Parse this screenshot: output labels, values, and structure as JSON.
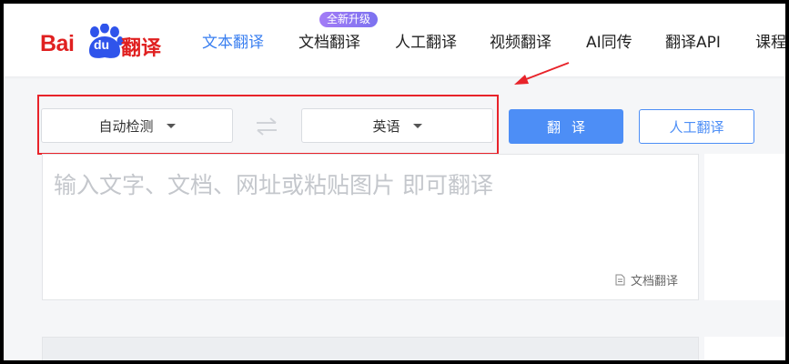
{
  "brand": {
    "logo_text_bai": "Bai",
    "logo_text_du": "du",
    "logo_text_fanyi": "翻译"
  },
  "nav": {
    "items": [
      {
        "label": "文本翻译",
        "active": true
      },
      {
        "label": "文档翻译",
        "active": false
      },
      {
        "label": "人工翻译",
        "active": false
      },
      {
        "label": "视频翻译",
        "active": false
      },
      {
        "label": "AI同传",
        "active": false
      },
      {
        "label": "翻译API",
        "active": false
      },
      {
        "label": "课程",
        "active": false
      }
    ],
    "badge": "全新升级"
  },
  "translator": {
    "source_language": "自动检测",
    "target_language": "英语",
    "translate_button": "翻译",
    "human_translate_button": "人工翻译",
    "input_placeholder": "输入文字、文档、网址或粘贴图片 即可翻译",
    "doc_translate_link": "文档翻译"
  },
  "colors": {
    "accent": "#4d8ef6",
    "nav_active": "#3a7ff0",
    "brand_red": "#e02020",
    "annotation_red": "#e8232a",
    "badge_purple": "#8f76f3"
  },
  "icons": [
    "baidu-paw-icon",
    "swap-arrows-icon",
    "chevron-down-icon",
    "document-icon",
    "annotation-arrow-icon"
  ]
}
